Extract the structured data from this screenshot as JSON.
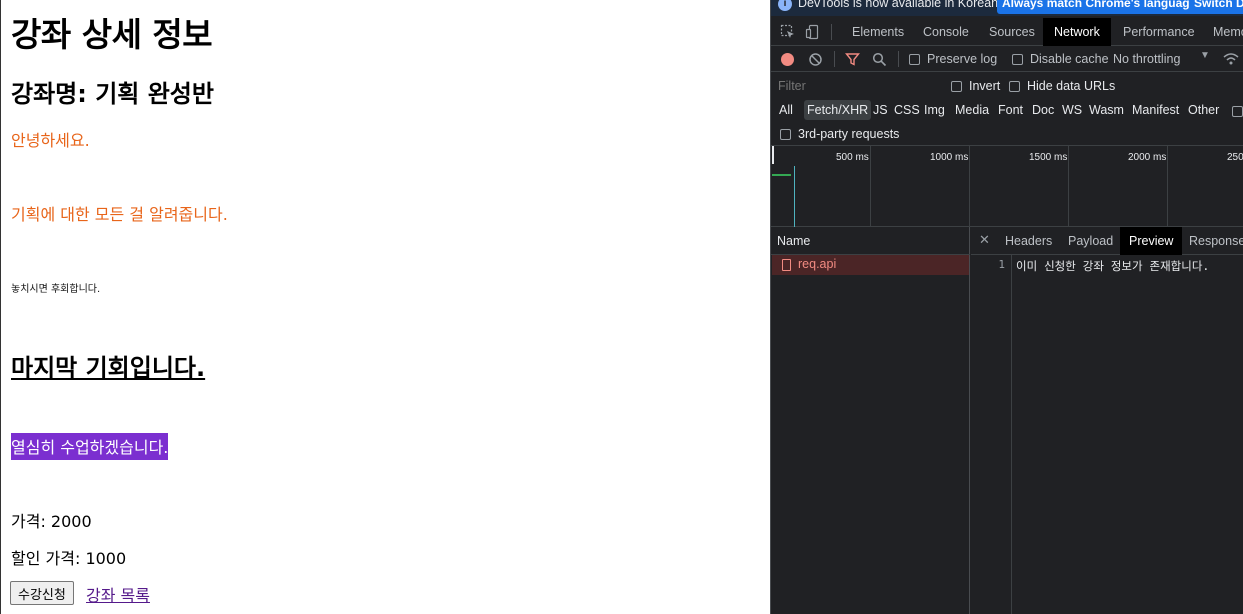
{
  "page": {
    "heading": "강좌 상세 정보",
    "course_title": "강좌명: 기획 완성반",
    "greeting": "안녕하세요.",
    "intro": "기획에 대한 모든 걸 알려줍니다.",
    "small_note": "놓치시면 후회합니다.",
    "last_chance": "마지막 기회입니다.",
    "study_hard": "열심히 수업하겠습니다.",
    "price": "가격: 2000",
    "discount_price": "할인 가격: 1000",
    "enroll_button": "수강신청",
    "list_link": "강좌 목록",
    "colors": {
      "orange_text": "#e8651a",
      "highlight_bg": "#7b2fd0",
      "link": "#551a8b"
    }
  },
  "devtools": {
    "infobar": {
      "icon": "info-icon",
      "message": "DevTools is now available in Korean!",
      "match_button": "Always match Chrome's language",
      "switch_button": "Switch De"
    },
    "tabs": [
      "Elements",
      "Console",
      "Sources",
      "Network",
      "Performance",
      "Memo"
    ],
    "active_tab": "Network",
    "toolbar": {
      "preserve_log": "Preserve log",
      "disable_cache": "Disable cache",
      "throttling": "No throttling"
    },
    "filter": {
      "placeholder": "Filter",
      "invert": "Invert",
      "hide_data_urls": "Hide data URLs",
      "types": [
        "All",
        "Fetch/XHR",
        "JS",
        "CSS",
        "Img",
        "Media",
        "Font",
        "Doc",
        "WS",
        "Wasm",
        "Manifest",
        "Other"
      ],
      "active_type": "Fetch/XHR",
      "third_party": "3rd-party requests"
    },
    "timeline": {
      "ticks": [
        "500 ms",
        "1000 ms",
        "1500 ms",
        "2000 ms",
        "250"
      ]
    },
    "requests": {
      "name_header": "Name",
      "items": [
        "req.api"
      ]
    },
    "detail": {
      "tabs": [
        "Headers",
        "Payload",
        "Preview",
        "Response"
      ],
      "active_tab": "Preview",
      "line_number": "1",
      "response_text": "이미 신청한 강좌 정보가 존재합니다."
    }
  }
}
